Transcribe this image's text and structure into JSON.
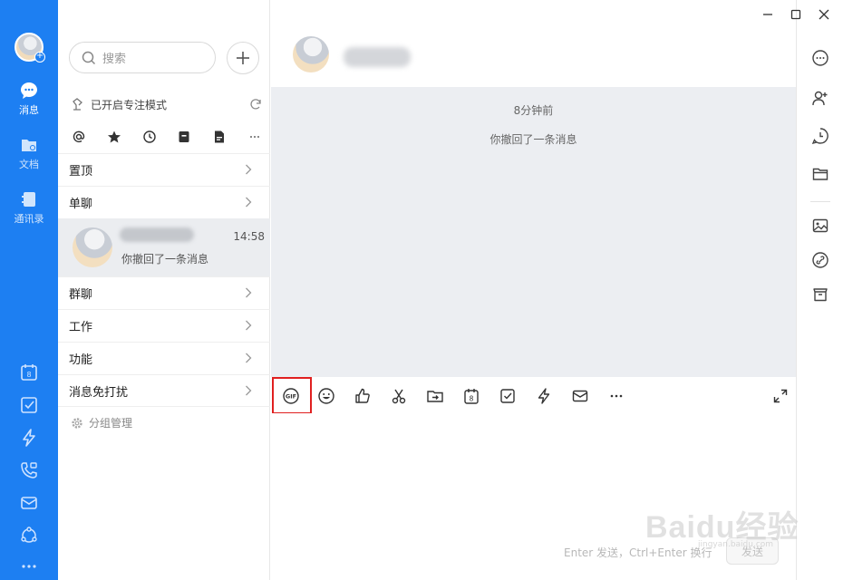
{
  "rail": {
    "messages_label": "消息",
    "docs_label": "文档",
    "contacts_label": "通讯录",
    "calendar_day": "8"
  },
  "list": {
    "search_placeholder": "搜索",
    "focus_mode": "已开启专注模式",
    "groups": [
      "置顶",
      "单聊",
      "群聊",
      "工作",
      "功能",
      "消息免打扰"
    ],
    "chat": {
      "time": "14:58",
      "preview": "你撤回了一条消息"
    },
    "group_management": "分组管理"
  },
  "chat": {
    "timestamp": "8分钟前",
    "system_message": "你撤回了一条消息",
    "toolbar_calendar_day": "8",
    "compose_hint": "Enter 发送，Ctrl+Enter 换行",
    "send_label": "发送"
  },
  "watermark": {
    "text": "Baidu经验",
    "sub": "jingyan.baidu.com"
  },
  "colors": {
    "rail": "#1d7ff2",
    "highlight": "#e02020",
    "message_bg": "#eceef2",
    "selected_item": "#ebedf0"
  }
}
